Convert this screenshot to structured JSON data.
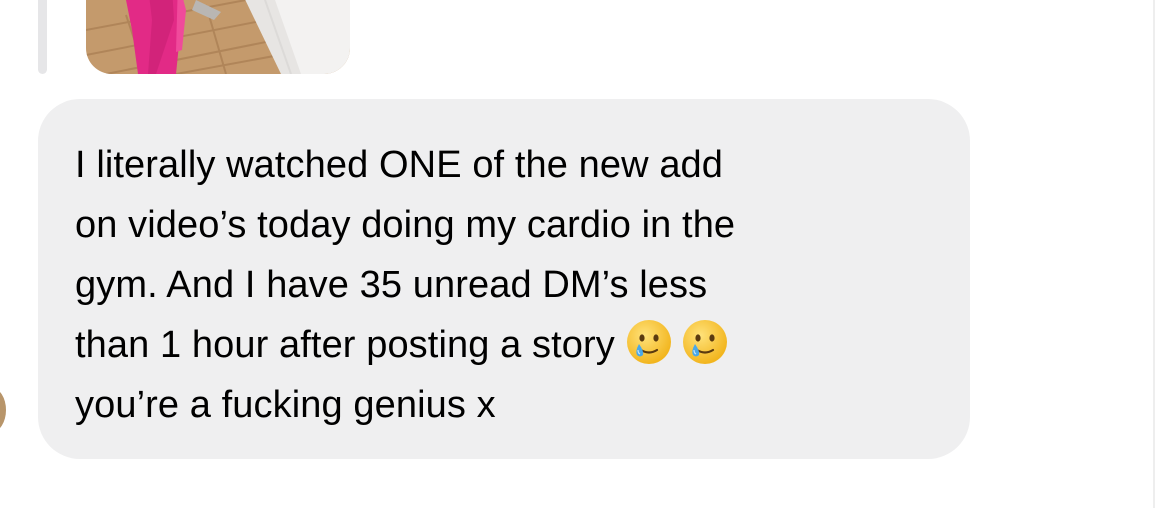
{
  "message": {
    "lines": [
      "I literally watched ONE of the new add",
      "on video’s today doing my cardio in the",
      "gym. And I have 35 unread DM’s less",
      "than 1 hour after posting a story",
      "you’re a fucking genius x"
    ],
    "emojis": [
      "smiling-face-with-tear",
      "smiling-face-with-tear"
    ]
  },
  "colors": {
    "bubble_background": "#efeff0",
    "text": "#000000",
    "reply_line": "#e6e6e8",
    "emoji_face": "#f9c43a",
    "tear": "#4aa8e8"
  },
  "icons": {
    "emoji": "smiling-face-with-tear-emoji",
    "avatar": "avatar"
  }
}
